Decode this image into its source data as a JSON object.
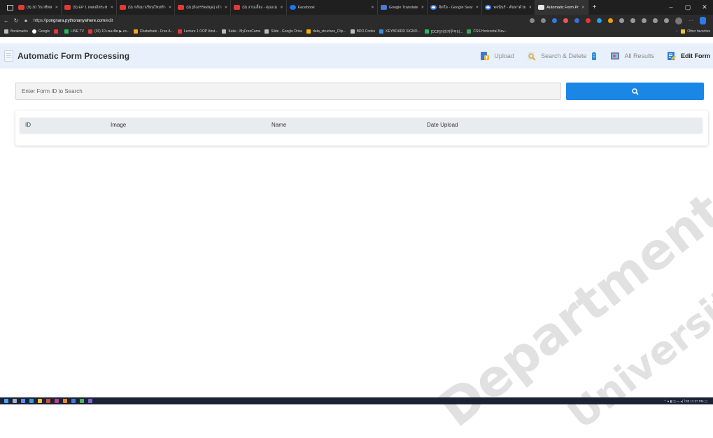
{
  "browser": {
    "tabs": [
      {
        "label": "(9) 30 วินาทีหล",
        "icon": "youtube-icon"
      },
      {
        "label": "(9) EP 1 เพลงอิสระห",
        "icon": "youtube-icon"
      },
      {
        "label": "(9) กลับมาเรียนใหม่ทำ",
        "icon": "youtube-icon"
      },
      {
        "label": "(9) [ยังสรรพสมุด] เจ้า",
        "icon": "youtube-icon"
      },
      {
        "label": "(9) งานเลี้ยง - คุณแม",
        "icon": "youtube-icon"
      },
      {
        "label": "Facebook",
        "icon": "facebook-icon"
      },
      {
        "label": "Google Translate",
        "icon": "google-translate-icon"
      },
      {
        "label": "จิตใจ - Google Sear",
        "icon": "google-icon"
      },
      {
        "label": "พจนีนร์ - ค้นหาด้วย",
        "icon": "google-icon"
      },
      {
        "label": "Automatic Form Pr",
        "icon": "page-icon",
        "active": true
      }
    ],
    "url_prefix": "https://",
    "url_host": "pongnara.pythonanywhere.com",
    "url_path": "/edit",
    "bookmarks": [
      "Bookmarks",
      "Google",
      "LINE TV",
      "(26) 10 เพลงฮิต ▶ เพ...",
      "Chaturbate - Free A...",
      "Lecture 1 OOP Abst...",
      "Katie - MyFreeCams",
      "Slide - Google Drive",
      "data_structure_Clip...",
      "BDO Codex",
      "KEYBOARD SIGNO...",
      "[OCR]이미지투부터...",
      "CSS Horizontal Nav...",
      "Other favorites"
    ]
  },
  "app": {
    "title": "Automatic Form Processing",
    "nav": [
      {
        "label": "Upload",
        "icon": "upload-icon",
        "active": false
      },
      {
        "label": "Search & Delete",
        "icon": "search-delete-icon",
        "active": false
      },
      {
        "label": "All Results",
        "icon": "all-results-icon",
        "active": false
      },
      {
        "label": "Edit Form",
        "icon": "edit-form-icon",
        "active": true
      }
    ],
    "search": {
      "placeholder": "Enter Form ID to Search",
      "value": ""
    },
    "table": {
      "columns": [
        "ID",
        "Image",
        "Name",
        "Date Upload"
      ],
      "rows": []
    }
  },
  "watermark": [
    "Department",
    "University"
  ],
  "taskbar": {
    "tray_time": "11:37 PM",
    "tray_lang": "ไทย"
  },
  "colors": {
    "header_bg": "#e8f1fb",
    "search_button": "#1a86e6",
    "tab_strip": "#1f1f1f"
  }
}
